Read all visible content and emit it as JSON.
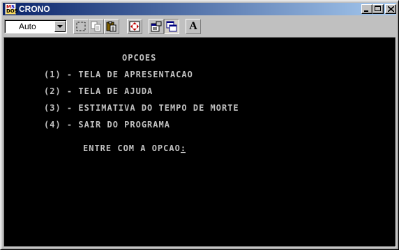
{
  "window": {
    "title": "CRONO",
    "icon": "ms-dos-icon"
  },
  "toolbar": {
    "font_size_value": "Auto",
    "buttons": [
      {
        "name": "mark-button",
        "icon": "mark-icon"
      },
      {
        "name": "copy-button",
        "icon": "copy-icon"
      },
      {
        "name": "paste-button",
        "icon": "paste-icon"
      },
      {
        "name": "fullscreen-button",
        "icon": "fullscreen-icon"
      },
      {
        "name": "properties-button",
        "icon": "properties-icon"
      },
      {
        "name": "background-button",
        "icon": "background-icon"
      },
      {
        "name": "font-button",
        "icon": "font-icon",
        "label": "A"
      }
    ]
  },
  "console": {
    "heading": "OPCOES",
    "options": [
      "(1) - TELA DE APRESENTACAO",
      "(2) - TELA DE AJUDA",
      "(3) - ESTIMATIVA DO TEMPO DE MORTE",
      "(4) - SAIR DO PROGRAMA"
    ],
    "prompt": "ENTRE COM A OPCAO:",
    "background_color": "#000000",
    "text_color": "#c0c0c0"
  },
  "colors": {
    "titlebar_start": "#0a246a",
    "titlebar_end": "#a6caf0",
    "chrome": "#c0c0c0"
  }
}
